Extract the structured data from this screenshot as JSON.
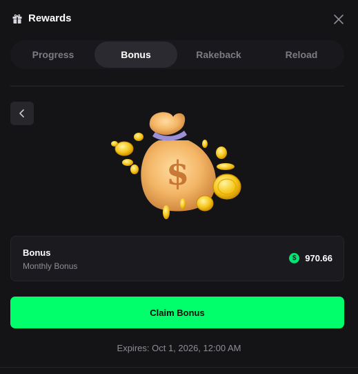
{
  "header": {
    "title": "Rewards",
    "gift_icon": "gift-icon",
    "close_icon": "close-icon"
  },
  "tabs": [
    {
      "label": "Progress",
      "active": false
    },
    {
      "label": "Bonus",
      "active": true
    },
    {
      "label": "Rakeback",
      "active": false
    },
    {
      "label": "Reload",
      "active": false
    }
  ],
  "back_icon": "chevron-left-icon",
  "illustration": "money-bag-with-coins",
  "bonus": {
    "name": "Bonus",
    "subtitle": "Monthly Bonus",
    "currency_icon": "dollar-icon",
    "currency_symbol": "$",
    "amount": "970.66"
  },
  "claim_label": "Claim Bonus",
  "expires_text": "Expires: Oct 1, 2026, 12:00 AM",
  "colors": {
    "background": "#141417",
    "accent": "#00ff6a",
    "card": "#1b1b1f",
    "muted_text": "#8d8d95"
  }
}
